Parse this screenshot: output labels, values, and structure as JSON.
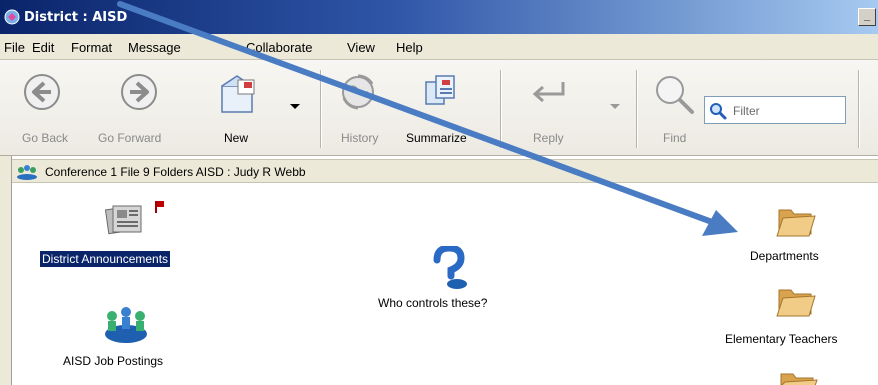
{
  "window": {
    "title": "District : AISD",
    "minimize_label": "_"
  },
  "menu": {
    "items": [
      {
        "label": "File"
      },
      {
        "label": "Edit"
      },
      {
        "label": "Format"
      },
      {
        "label": "Message"
      },
      {
        "label": "Collaborate"
      },
      {
        "label": "View"
      },
      {
        "label": "Help"
      }
    ]
  },
  "toolbar": {
    "go_back": "Go Back",
    "go_forward": "Go Forward",
    "new": "New",
    "history": "History",
    "summarize": "Summarize",
    "reply": "Reply",
    "find": "Find",
    "filter_placeholder": "Filter"
  },
  "location": {
    "text": "Conference   1 File  9 Folders   AISD : Judy R Webb"
  },
  "items": {
    "district_announcements": "District Announcements",
    "who_controls": "Who controls these?",
    "aisd_job_postings": "AISD Job Postings",
    "departments": "Departments",
    "elementary_teachers": "Elementary Teachers"
  },
  "colors": {
    "selection": "#0a246a",
    "arrow": "#4a7cc4",
    "folder": "#e8b86a"
  }
}
